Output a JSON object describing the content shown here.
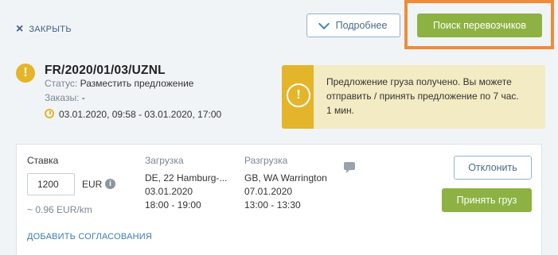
{
  "header": {
    "close_icon": "×",
    "close_label": "ЗАКРЫТЬ",
    "more_label": "Подробнее",
    "search_label": "Поиск перевозчиков"
  },
  "order": {
    "warning_icon": "!",
    "id": "FR/2020/01/03/UZNL",
    "status_key": "Статус:",
    "status_value": "Разместить предложение",
    "orders_key": "Заказы:",
    "orders_value": "-",
    "period": "03.01.2020, 09:58 - 03.01.2020, 17:00"
  },
  "notice": {
    "icon": "!",
    "text": "Предложение груза получено. Вы можете отправить / принять предложение по 7 час. 1 мин."
  },
  "offer": {
    "rate_label": "Ставка",
    "rate_value": "1200",
    "currency": "EUR",
    "info_icon": "i",
    "per_km": "~ 0.96 EUR/km",
    "loading_label": "Загрузка",
    "loading_place": "DE, 22 Hamburg-...",
    "loading_date": "03.01.2020",
    "loading_time": "18:00 - 19:00",
    "unloading_label": "Разгрузка",
    "unloading_place": "GB, WA Warrington",
    "unloading_date": "07.01.2020",
    "unloading_time": "13:00 - 13:30",
    "reject_label": "Отклонить",
    "accept_label": "Принять груз",
    "add_agreements_label": "ДОБАВИТЬ СОГЛАСОВАНИЯ"
  },
  "colors": {
    "accent_green": "#8db243",
    "warning_yellow": "#e4b52a",
    "highlight_orange": "#ef8c3a",
    "link_blue": "#3c7bb0"
  }
}
